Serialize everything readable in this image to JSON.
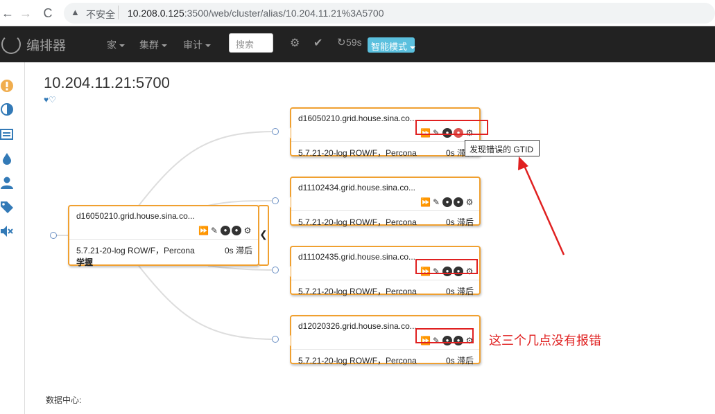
{
  "browser": {
    "back": "←",
    "forward": "→",
    "reload": "C",
    "insecure_label": "不安全",
    "url_host": "10.208.0.125",
    "url_rest": ":3500/web/cluster/alias/10.204.11.21%3A5700"
  },
  "navbar": {
    "brand": "编排器",
    "menu": [
      {
        "label": "家"
      },
      {
        "label": "集群"
      },
      {
        "label": "审计"
      }
    ],
    "search_placeholder": "搜索",
    "refresh_countdown": "59s",
    "smart_mode": "智能模式"
  },
  "sidebar": {
    "icons": [
      "alert-icon",
      "contrast-icon",
      "list-icon",
      "drop-icon",
      "user-icon",
      "tag-icon",
      "mute-icon"
    ]
  },
  "cluster": {
    "title": "10.204.11.21:5700",
    "hearts": "♥♡",
    "datacenter_label": "数据中心:"
  },
  "master": {
    "host": "d16050210.grid.house.sina.co...",
    "version": "5.7.21-20-log ROW/F，Percona",
    "lag": "0s 滞后",
    "extra": "学握"
  },
  "replicas": [
    {
      "host": "d16050210.grid.house.sina.co...",
      "version": "5.7.21-20-log ROW/F，Percona",
      "lag": "0s 滞后",
      "error": true
    },
    {
      "host": "d11102434.grid.house.sina.co...",
      "version": "5.7.21-20-log ROW/F，Percona",
      "lag": "0s 滞后",
      "error": false
    },
    {
      "host": "d11102435.grid.house.sina.co...",
      "version": "5.7.21-20-log ROW/F，Percona",
      "lag": "0s 滞后",
      "error": false
    },
    {
      "host": "d12020326.grid.house.sina.co...",
      "version": "5.7.21-20-log ROW/F，Percona",
      "lag": "0s 滞后",
      "error": false
    }
  ],
  "tooltip": "发现错误的 GTID",
  "annotation": "这三个几点没有报错",
  "colors": {
    "node_border": "#f0a030",
    "highlight": "#e02020",
    "smart_button": "#5bc0de",
    "navbar": "#222222"
  }
}
